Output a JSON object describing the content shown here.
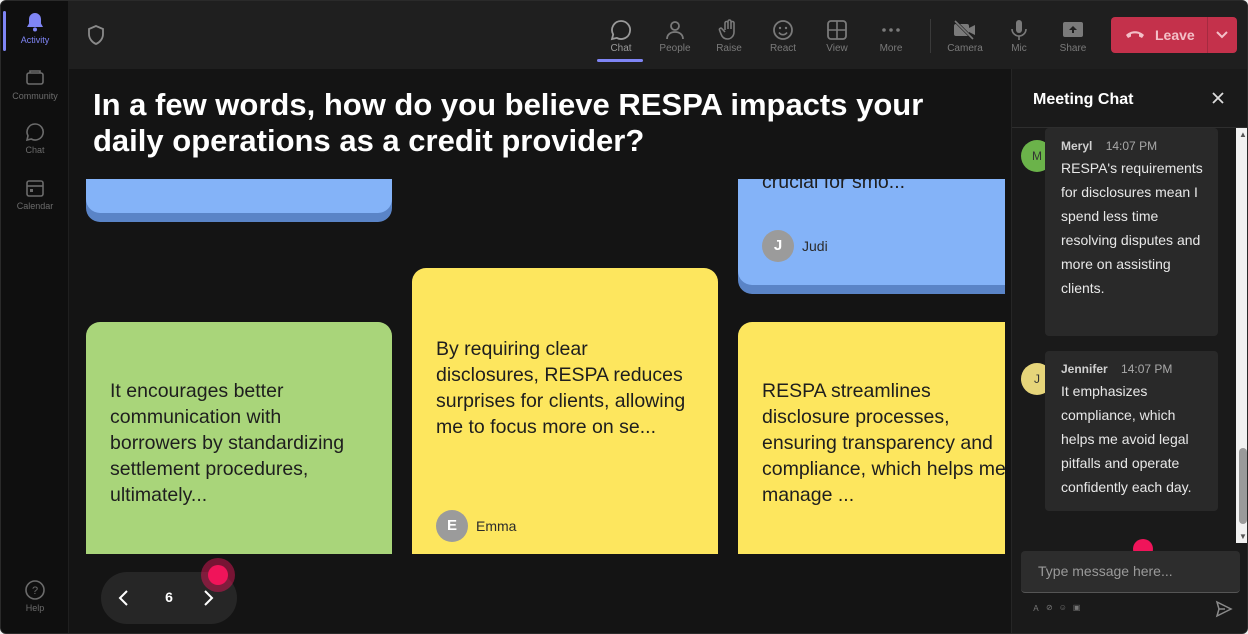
{
  "rail": {
    "items": [
      {
        "label": "Activity",
        "icon": "bell-icon",
        "active": true
      },
      {
        "label": "Community",
        "icon": "community-icon"
      },
      {
        "label": "Chat",
        "icon": "chat-icon"
      },
      {
        "label": "Calendar",
        "icon": "calendar-icon"
      }
    ],
    "help_label": "Help"
  },
  "toolbar": {
    "buttons": [
      {
        "label": "Chat",
        "icon": "chat-icon",
        "active": true
      },
      {
        "label": "People",
        "icon": "people-icon"
      },
      {
        "label": "Raise",
        "icon": "raise-hand-icon"
      },
      {
        "label": "React",
        "icon": "react-icon"
      },
      {
        "label": "View",
        "icon": "view-grid-icon"
      },
      {
        "label": "More",
        "icon": "more-icon"
      },
      {
        "label": "Camera",
        "icon": "camera-off-icon"
      },
      {
        "label": "Mic",
        "icon": "mic-icon"
      },
      {
        "label": "Share",
        "icon": "share-icon"
      }
    ],
    "leave_label": "Leave",
    "leave_color": "#c4314b"
  },
  "question": "In a few words, how do you believe RESPA impacts your daily operations as a credit provider?",
  "cards": [
    {
      "text": "",
      "color": "blue"
    },
    {
      "text": "crucial for smo...",
      "author": "Judi",
      "initial": "J",
      "color": "blue"
    },
    {
      "text": "It encourages better communication with borrowers by standardizing settlement procedures, ultimately...",
      "color": "green"
    },
    {
      "text": "By requiring clear disclosures, RESPA reduces surprises for clients, allowing me to focus more on se...",
      "author": "Emma",
      "initial": "E",
      "color": "yellow"
    },
    {
      "text": "RESPA streamlines disclosure processes, ensuring transparency and compliance, which helps me manage ...",
      "color": "yellow"
    }
  ],
  "pager": {
    "page": "6"
  },
  "chat": {
    "title": "Meeting Chat",
    "messages": [
      {
        "name": "Meryl",
        "initial": "M",
        "time": "14:07 PM",
        "text": "RESPA's requirements for disclosures mean I spend less time resolving disputes and more on assisting clients.",
        "avatar_color": "#6bb34a"
      },
      {
        "name": "Jennifer",
        "initial": "J",
        "time": "14:07 PM",
        "text": "It emphasizes compliance, which helps me avoid legal pitfalls and operate confidently each day.",
        "avatar_color": "#e6d57a"
      }
    ],
    "input_placeholder": "Type message here..."
  },
  "colors": {
    "accent": "#7f85f5",
    "cursor": "#f0145a",
    "blue_card": "#84b3f8",
    "green_card": "#a9d57a",
    "yellow_card": "#fde65e"
  }
}
